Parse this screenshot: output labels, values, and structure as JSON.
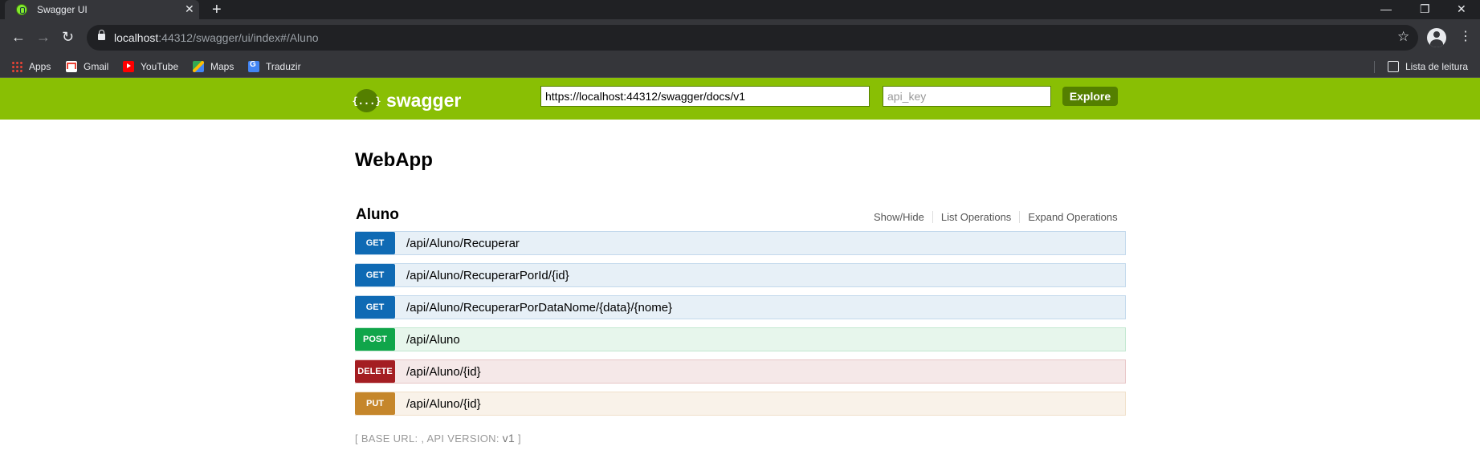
{
  "browser": {
    "tab_title": "Swagger UI",
    "tab_close": "✕",
    "new_tab": "+",
    "window_minimize": "—",
    "window_restore": "❐",
    "window_close": "✕",
    "url_host": "localhost",
    "url_rest": ":44312/swagger/ui/index#/Aluno",
    "bookmarks": [
      {
        "label": "Apps",
        "icon": "apps-grid-icon"
      },
      {
        "label": "Gmail",
        "icon": "gmail-icon"
      },
      {
        "label": "YouTube",
        "icon": "youtube-icon"
      },
      {
        "label": "Maps",
        "icon": "maps-icon"
      },
      {
        "label": "Traduzir",
        "icon": "translate-icon"
      }
    ],
    "reading_list": "Lista de leitura"
  },
  "swagger": {
    "logo_symbol": "{...}",
    "logo_text": "swagger",
    "url_value": "https://localhost:44312/swagger/docs/v1",
    "api_key_placeholder": "api_key",
    "explore_label": "Explore",
    "brand_color": "#89bf04"
  },
  "app_title": "WebApp",
  "resource": {
    "name": "Aluno",
    "links": [
      "Show/Hide",
      "List Operations",
      "Expand Operations"
    ]
  },
  "operations": [
    {
      "method": "GET",
      "path": "/api/Aluno/Recuperar"
    },
    {
      "method": "GET",
      "path": "/api/Aluno/RecuperarPorId/{id}"
    },
    {
      "method": "GET",
      "path": "/api/Aluno/RecuperarPorDataNome/{data}/{nome}"
    },
    {
      "method": "POST",
      "path": "/api/Aluno"
    },
    {
      "method": "DELETE",
      "path": "/api/Aluno/{id}"
    },
    {
      "method": "PUT",
      "path": "/api/Aluno/{id}"
    }
  ],
  "footer": {
    "prefix": "[ BASE URL: , API VERSION: ",
    "version": "v1",
    "suffix": " ]"
  }
}
